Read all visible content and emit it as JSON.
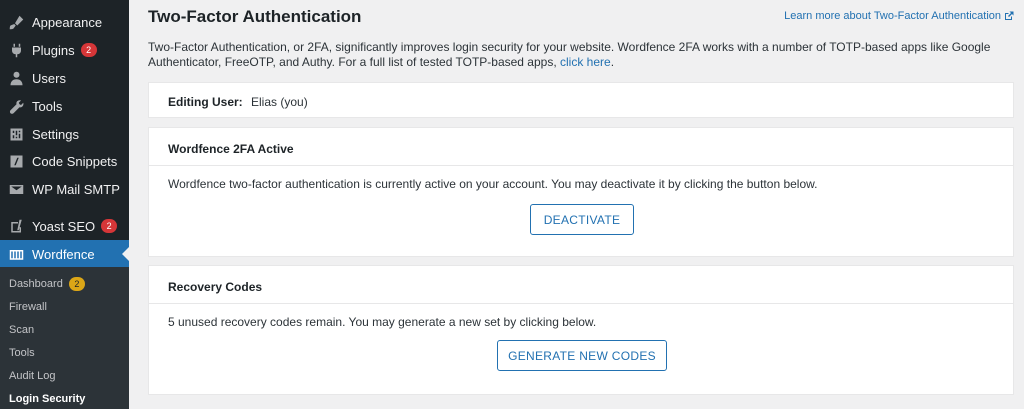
{
  "sidebar": {
    "items": [
      {
        "label": "Appearance",
        "icon": "paintbrush-icon"
      },
      {
        "label": "Plugins",
        "icon": "plugin-icon",
        "badge": "2"
      },
      {
        "label": "Users",
        "icon": "user-icon"
      },
      {
        "label": "Tools",
        "icon": "wrench-icon"
      },
      {
        "label": "Settings",
        "icon": "settings-icon"
      },
      {
        "label": "Code Snippets",
        "icon": "code-icon"
      },
      {
        "label": "WP Mail SMTP",
        "icon": "mail-icon"
      },
      {
        "label": "Yoast SEO",
        "icon": "yoast-icon",
        "badge": "2"
      },
      {
        "label": "Wordfence",
        "icon": "wordfence-icon"
      }
    ],
    "submenu": [
      {
        "label": "Dashboard",
        "badge": "2"
      },
      {
        "label": "Firewall"
      },
      {
        "label": "Scan"
      },
      {
        "label": "Tools"
      },
      {
        "label": "Audit Log"
      },
      {
        "label": "Login Security"
      }
    ]
  },
  "header": {
    "title": "Two-Factor Authentication",
    "learn_more": "Learn more about Two-Factor Authentication"
  },
  "intro": {
    "text": "Two-Factor Authentication, or 2FA, significantly improves login security for your website. Wordfence 2FA works with a number of TOTP-based apps like Google Authenticator, FreeOTP, and Authy. For a full list of tested TOTP-based apps, ",
    "link": "click here",
    "suffix": "."
  },
  "editing_user": {
    "label": "Editing User:",
    "value": "Elias (you)"
  },
  "active_card": {
    "title": "Wordfence 2FA Active",
    "text": "Wordfence two-factor authentication is currently active on your account. You may deactivate it by clicking the button below.",
    "button": "DEACTIVATE"
  },
  "recovery_card": {
    "title": "Recovery Codes",
    "text": "5 unused recovery codes remain. You may generate a new set by clicking below.",
    "button": "GENERATE NEW CODES"
  },
  "colors": {
    "sidebar_bg": "#1d2327",
    "accent": "#2271b1",
    "badge_red": "#d63638",
    "badge_orange": "#dba617"
  }
}
